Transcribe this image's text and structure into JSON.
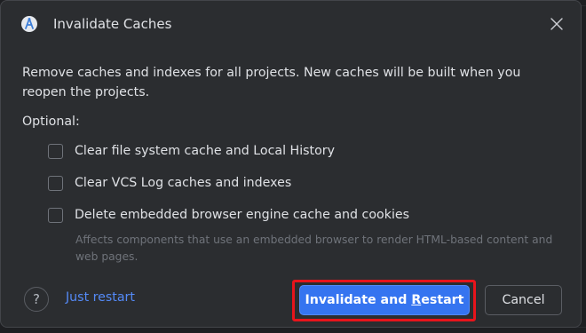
{
  "dialog": {
    "title": "Invalidate Caches",
    "app_icon": "android-studio-icon",
    "close_icon": "close-icon",
    "description": "Remove caches and indexes for all projects. New caches will be built when you reopen the projects.",
    "optional_label": "Optional:",
    "options": [
      {
        "label": "Clear file system cache and Local History",
        "checked": false
      },
      {
        "label": "Clear VCS Log caches and indexes",
        "checked": false
      },
      {
        "label": "Delete embedded browser engine cache and cookies",
        "checked": false
      }
    ],
    "option_hint": "Affects components that use an embedded browser to render HTML-based content and web pages.",
    "help_label": "?",
    "just_restart_label": "Just restart",
    "primary_button": {
      "before": "Invalidate and ",
      "mnemonic": "R",
      "after": "estart"
    },
    "cancel_label": "Cancel"
  },
  "colors": {
    "dialog_bg": "#2b2d30",
    "text": "#dfe1e5",
    "hint": "#6f737a",
    "link": "#548af7",
    "primary": "#3574f0",
    "highlight": "#e8141b"
  }
}
